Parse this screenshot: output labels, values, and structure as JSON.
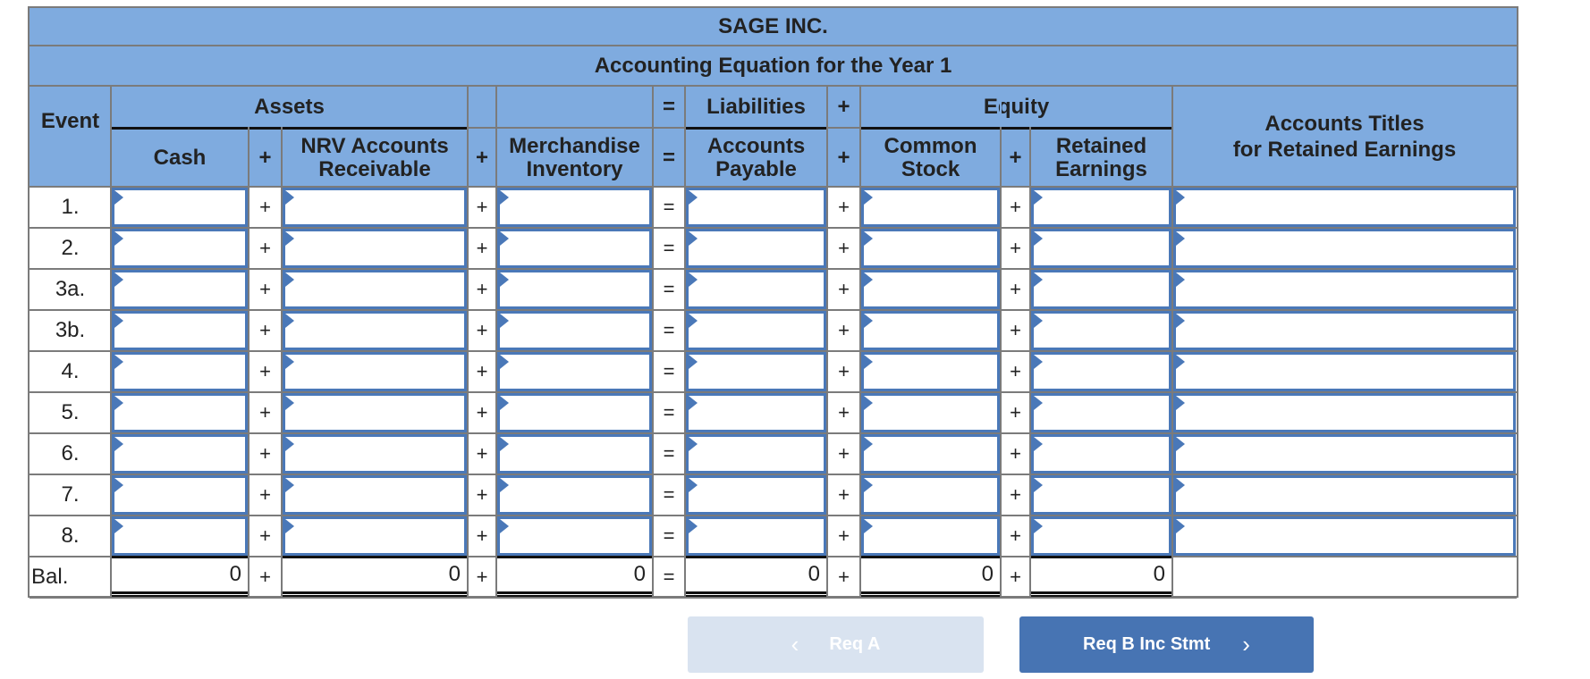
{
  "table": {
    "company": "SAGE INC.",
    "subtitle": "Accounting Equation for the Year 1",
    "groups": {
      "assets": "Assets",
      "equals": "=",
      "liabilities": "Liabilities",
      "plus": "+",
      "equity": "Equity"
    },
    "columns": {
      "event": "Event",
      "cash": "Cash",
      "nrv_accounts_receivable_line1": "NRV Accounts",
      "nrv_accounts_receivable_line2": "Receivable",
      "merchandise_inventory_line1": "Merchandise",
      "merchandise_inventory_line2": "Inventory",
      "accounts_payable_line1": "Accounts",
      "accounts_payable_line2": "Payable",
      "common_stock_line1": "Common",
      "common_stock_line2": "Stock",
      "retained_earnings_line1": "Retained",
      "retained_earnings_line2": "Earnings",
      "account_titles_line1": "Accounts Titles",
      "account_titles_line2": "for Retained Earnings"
    },
    "operators": {
      "plus": "+",
      "equals": "="
    },
    "rows": [
      {
        "event": "1.",
        "cash": "",
        "nrv_ar": "",
        "merch_inv": "",
        "ap": "",
        "common_stock": "",
        "retained_earnings": "",
        "account_title": ""
      },
      {
        "event": "2.",
        "cash": "",
        "nrv_ar": "",
        "merch_inv": "",
        "ap": "",
        "common_stock": "",
        "retained_earnings": "",
        "account_title": ""
      },
      {
        "event": "3a.",
        "cash": "",
        "nrv_ar": "",
        "merch_inv": "",
        "ap": "",
        "common_stock": "",
        "retained_earnings": "",
        "account_title": ""
      },
      {
        "event": "3b.",
        "cash": "",
        "nrv_ar": "",
        "merch_inv": "",
        "ap": "",
        "common_stock": "",
        "retained_earnings": "",
        "account_title": ""
      },
      {
        "event": "4.",
        "cash": "",
        "nrv_ar": "",
        "merch_inv": "",
        "ap": "",
        "common_stock": "",
        "retained_earnings": "",
        "account_title": ""
      },
      {
        "event": "5.",
        "cash": "",
        "nrv_ar": "",
        "merch_inv": "",
        "ap": "",
        "common_stock": "",
        "retained_earnings": "",
        "account_title": ""
      },
      {
        "event": "6.",
        "cash": "",
        "nrv_ar": "",
        "merch_inv": "",
        "ap": "",
        "common_stock": "",
        "retained_earnings": "",
        "account_title": ""
      },
      {
        "event": "7.",
        "cash": "",
        "nrv_ar": "",
        "merch_inv": "",
        "ap": "",
        "common_stock": "",
        "retained_earnings": "",
        "account_title": ""
      },
      {
        "event": "8.",
        "cash": "",
        "nrv_ar": "",
        "merch_inv": "",
        "ap": "",
        "common_stock": "",
        "retained_earnings": "",
        "account_title": ""
      }
    ],
    "balance": {
      "event": "Bal.",
      "cash": "0",
      "nrv_ar": "0",
      "merch_inv": "0",
      "ap": "0",
      "common_stock": "0",
      "retained_earnings": "0"
    }
  },
  "navigation": {
    "prev_label": "Req A",
    "next_label": "Req B Inc Stmt",
    "prev_icon": "chevron-left-icon",
    "next_icon": "chevron-right-icon",
    "prev_glyph": "‹",
    "next_glyph": "›"
  },
  "colors": {
    "header_bg": "#7fabdf",
    "input_border": "#4a78b8",
    "next_button": "#4774b3",
    "prev_button_disabled": "#d9e3f0"
  }
}
